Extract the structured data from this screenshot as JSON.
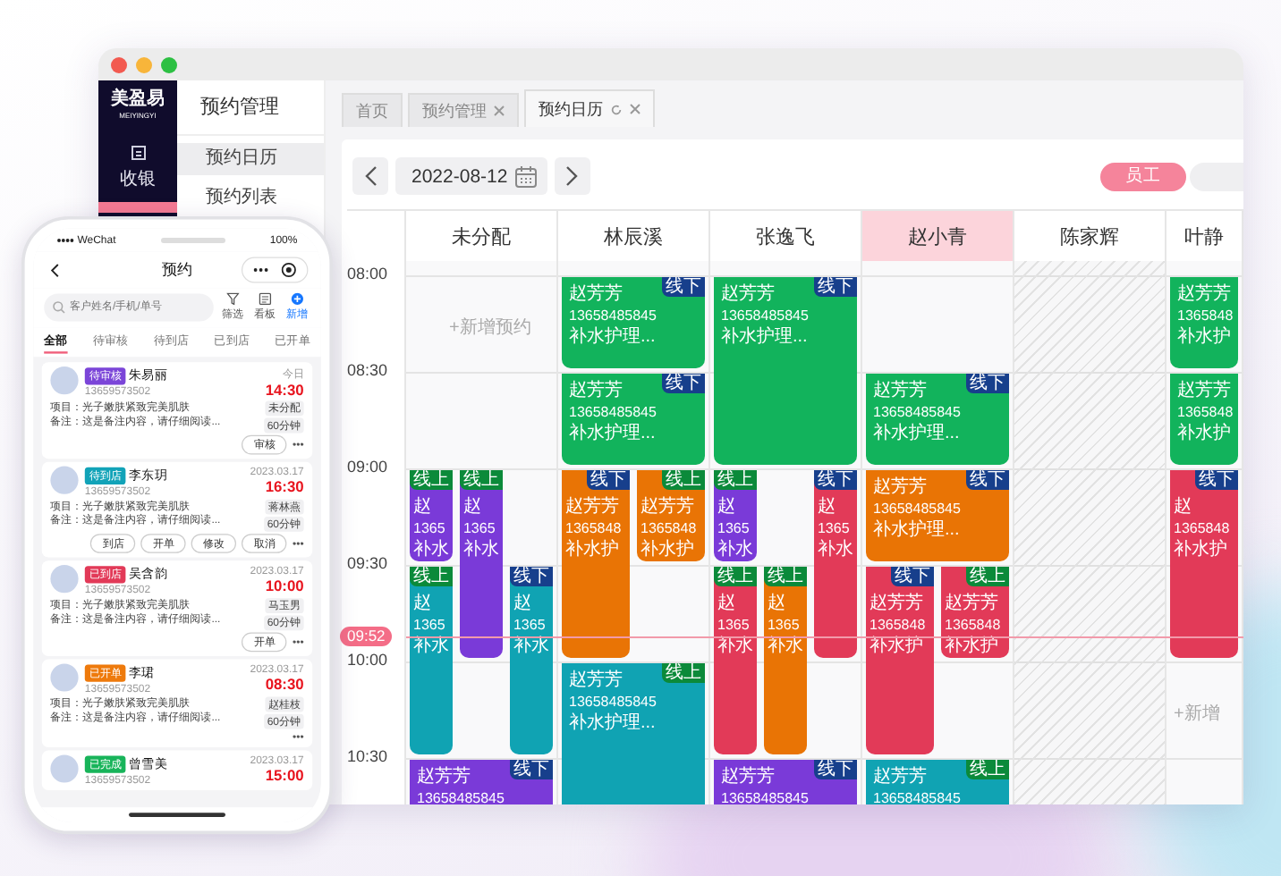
{
  "sidebar": {
    "logo": "美盈易",
    "logo_sub": "MEIYINGYI",
    "items": [
      {
        "label": "收银",
        "selected": false
      },
      {
        "selected": true
      }
    ]
  },
  "submenu": {
    "title": "预约管理",
    "items": [
      {
        "label": "预约日历",
        "selected": true
      },
      {
        "label": "预约列表",
        "selected": false
      }
    ]
  },
  "tabs": [
    {
      "label": "首页",
      "selected": false,
      "closable": false,
      "refreshable": false
    },
    {
      "label": "预约管理",
      "selected": false,
      "closable": true,
      "refreshable": false
    },
    {
      "label": "预约日历",
      "selected": true,
      "closable": true,
      "refreshable": true
    }
  ],
  "toolbar": {
    "date": "2022-08-12",
    "views": [
      {
        "label": "员工",
        "selected": true
      },
      {
        "selected": false
      }
    ]
  },
  "calendar": {
    "times": [
      "08:00",
      "08:30",
      "09:00",
      "09:30",
      "10:00",
      "10:30"
    ],
    "now": "09:52",
    "columns": [
      {
        "name": "未分配",
        "selected": false,
        "unavailable": false,
        "add_hint": "+新增预约",
        "events": [
          {
            "color": "#7a3ad8",
            "kind": "online",
            "tag": "线上",
            "name": "赵",
            "phone": "1365",
            "service": "补水"
          },
          {
            "color": "#7a3ad8",
            "kind": "online",
            "tag": "线上",
            "name": "赵",
            "phone": "1365",
            "service": "补水"
          },
          {
            "color": "#10a3b3",
            "kind": "online",
            "tag": "线上",
            "name": "赵",
            "phone": "1365",
            "service": "补水"
          },
          {
            "color": "#10a3b3",
            "kind": "offline",
            "tag": "线下",
            "name": "赵",
            "phone": "1365",
            "service": "补水"
          },
          {
            "color": "#7a3ad8",
            "kind": "offline",
            "tag": "线下",
            "name": "赵芳芳",
            "phone": "13658485845"
          }
        ]
      },
      {
        "name": "林辰溪",
        "selected": false,
        "unavailable": false,
        "events": [
          {
            "color": "#12b35c",
            "kind": "offline",
            "tag": "线下",
            "name": "赵芳芳",
            "phone": "13658485845",
            "service": "补水护理..."
          },
          {
            "color": "#12b35c",
            "kind": "offline",
            "tag": "线下",
            "name": "赵芳芳",
            "phone": "13658485845",
            "service": "补水护理..."
          },
          {
            "color": "#e97405",
            "kind": "offline",
            "tag": "线下",
            "name": "赵芳芳",
            "phone": "1365848",
            "service": "补水护"
          },
          {
            "color": "#e97405",
            "kind": "online",
            "tag": "线上",
            "name": "赵芳芳",
            "phone": "1365848",
            "service": "补水护"
          },
          {
            "color": "#10a3b3",
            "kind": "online",
            "tag": "线上",
            "name": "赵芳芳",
            "phone": "13658485845",
            "service": "补水护理..."
          }
        ]
      },
      {
        "name": "张逸飞",
        "selected": false,
        "unavailable": false,
        "events": [
          {
            "color": "#12b35c",
            "kind": "offline",
            "tag": "线下",
            "name": "赵芳芳",
            "phone": "13658485845",
            "service": "补水护理..."
          },
          {
            "color": "#7a3ad8",
            "kind": "online",
            "tag": "线上",
            "name": "赵",
            "phone": "1365",
            "service": "补水"
          },
          {
            "color": "#e23a58",
            "kind": "offline",
            "tag": "线下",
            "name": "赵",
            "phone": "1365",
            "service": "补水"
          },
          {
            "color": "#e23a58",
            "kind": "online",
            "tag": "线上",
            "name": "赵",
            "phone": "1365",
            "service": "补水"
          },
          {
            "color": "#e97405",
            "kind": "online",
            "tag": "线上",
            "name": "赵",
            "phone": "1365",
            "service": "补水"
          },
          {
            "color": "#7a3ad8",
            "kind": "offline",
            "tag": "线下",
            "name": "赵芳芳",
            "phone": "13658485845"
          }
        ]
      },
      {
        "name": "赵小青",
        "selected": true,
        "unavailable": false,
        "events": [
          {
            "color": "#12b35c",
            "kind": "offline",
            "tag": "线下",
            "name": "赵芳芳",
            "phone": "13658485845",
            "service": "补水护理..."
          },
          {
            "color": "#e97405",
            "kind": "offline",
            "tag": "线下",
            "name": "赵芳芳",
            "phone": "13658485845",
            "service": "补水护理..."
          },
          {
            "color": "#e23a58",
            "kind": "offline",
            "tag": "线下",
            "name": "赵芳芳",
            "phone": "1365848",
            "service": "补水护"
          },
          {
            "color": "#e23a58",
            "kind": "online",
            "tag": "线上",
            "name": "赵芳芳",
            "phone": "1365848",
            "service": "补水护"
          },
          {
            "color": "#10a3b3",
            "kind": "online",
            "tag": "线上",
            "name": "赵芳芳",
            "phone": "13658485845"
          }
        ]
      },
      {
        "name": "陈家辉",
        "selected": false,
        "unavailable": true
      },
      {
        "name": "叶静",
        "selected": false,
        "unavailable": false,
        "add_hint": "+新增",
        "events": [
          {
            "color": "#12b35c",
            "name": "赵芳芳",
            "phone": "1365848",
            "service": "补水护"
          },
          {
            "color": "#12b35c",
            "name": "赵芳芳",
            "phone": "1365848",
            "service": "补水护"
          },
          {
            "color": "#e23a58",
            "kind": "offline",
            "tag": "线下",
            "name": "赵",
            "phone": "1365848",
            "service": "补水护"
          }
        ]
      }
    ]
  },
  "phone": {
    "carrier": "WeChat",
    "battery": "100%",
    "title": "预约",
    "search_placeholder": "客户姓名/手机/单号",
    "actions": [
      {
        "label": "筛选",
        "kind": "filter"
      },
      {
        "label": "看板",
        "kind": "board"
      },
      {
        "label": "新增",
        "kind": "add"
      }
    ],
    "tabs": [
      {
        "label": "全部",
        "selected": true
      },
      {
        "label": "待审核",
        "selected": false
      },
      {
        "label": "待到店",
        "selected": false
      },
      {
        "label": "已到店",
        "selected": false
      },
      {
        "label": "已开单",
        "selected": false
      }
    ],
    "cards": [
      {
        "status": "待审核",
        "color": "#7b45d8",
        "name": "朱易丽",
        "phone": "13659573502",
        "project": "项目：光子嫩肤紧致完美肌肤",
        "note": "备注：这是备注内容，请仔细阅读...",
        "date": "今日",
        "time": "14:30",
        "tags": [
          "未分配",
          "60分钟"
        ],
        "actions": [
          "审核"
        ],
        "more": "•••"
      },
      {
        "status": "待到店",
        "color": "#12a3b8",
        "name": "李东玥",
        "phone": "13659573502",
        "project": "项目：光子嫩肤紧致完美肌肤",
        "note": "备注：这是备注内容，请仔细阅读...",
        "date": "2023.03.17",
        "time": "16:30",
        "tags": [
          "蒋林燕",
          "60分钟"
        ],
        "actions": [
          "到店",
          "开单",
          "修改",
          "取消"
        ],
        "more": "•••"
      },
      {
        "status": "已到店",
        "color": "#e23a58",
        "name": "吴含韵",
        "phone": "13659573502",
        "project": "项目：光子嫩肤紧致完美肌肤",
        "note": "备注：这是备注内容，请仔细阅读...",
        "date": "2023.03.17",
        "time": "10:00",
        "tags": [
          "马玉男",
          "60分钟"
        ],
        "actions": [
          "开单"
        ],
        "more": "•••"
      },
      {
        "status": "已开单",
        "color": "#ee7a0c",
        "name": "李珺",
        "phone": "13659573502",
        "project": "项目：光子嫩肤紧致完美肌肤",
        "note": "备注：这是备注内容，请仔细阅读...",
        "date": "2023.03.17",
        "time": "08:30",
        "tags": [
          "赵桂枝",
          "60分钟"
        ],
        "more": "•••"
      },
      {
        "status": "已完成",
        "color": "#18b45a",
        "name": "曾雪美",
        "phone": "13659573502",
        "date": "2023.03.17",
        "time": "15:00"
      }
    ]
  }
}
